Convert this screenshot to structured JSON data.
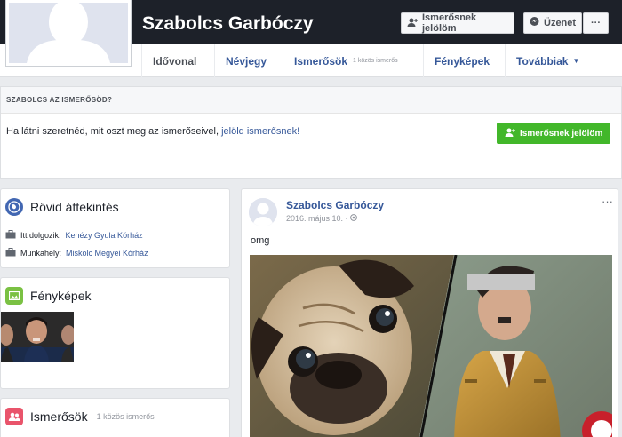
{
  "profile": {
    "name": "Szabolcs Garbóczy"
  },
  "cover_buttons": {
    "add_friend": "Ismerősnek jelölöm",
    "message": "Üzenet",
    "more": "···"
  },
  "nav": {
    "items": [
      {
        "label": "Idővonal"
      },
      {
        "label": "Névjegy"
      },
      {
        "label": "Ismerősök",
        "sub": "1 közös ismerős"
      },
      {
        "label": "Fényképek"
      },
      {
        "label": "Továbbiak"
      }
    ]
  },
  "friend_request": {
    "header": "SZABOLCS AZ ISMERŐSÖD?",
    "text": "Ha látni szeretnéd, mit oszt meg az ismerőseivel,",
    "link": "jelöld ismerősnek!",
    "button": "Ismerősnek jelölöm"
  },
  "intro": {
    "title": "Rövid áttekintés",
    "rows": [
      {
        "prefix": "Itt dolgozik:",
        "value": "Kenézy Gyula Kórház"
      },
      {
        "prefix": "Munkahely:",
        "value": "Miskolc Megyei Kórház"
      }
    ]
  },
  "photos": {
    "title": "Fényképek"
  },
  "friends": {
    "title": "Ismerősök",
    "sub": "1 közös ismerős"
  },
  "post": {
    "author": "Szabolcs Garbóczy",
    "date": "2016. május 10. ·",
    "text": "omg",
    "dots": "···"
  },
  "colors": {
    "link": "#365899",
    "cover": "#1d2129",
    "green_button": "#42b72a"
  }
}
